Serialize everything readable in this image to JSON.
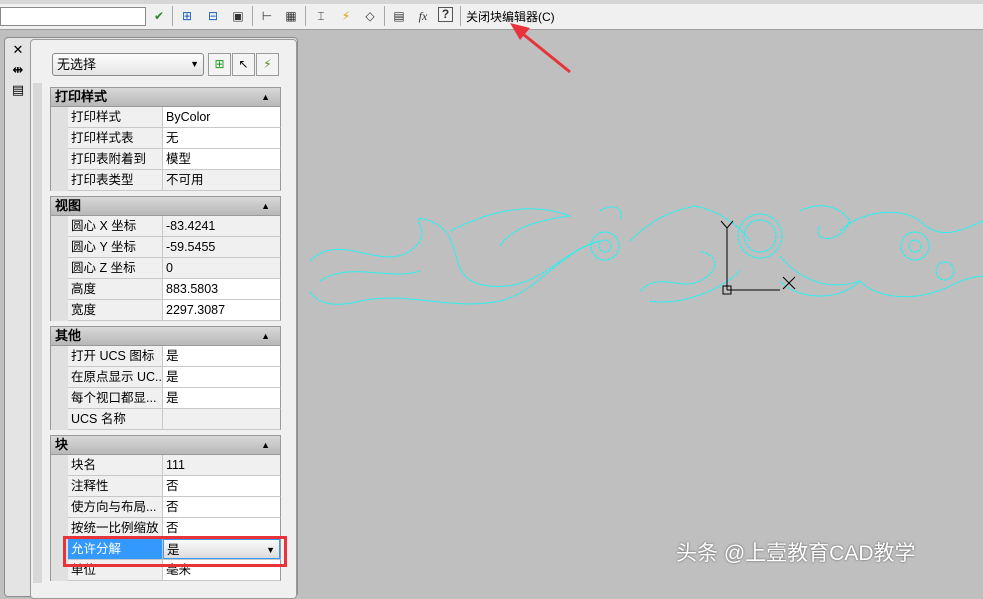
{
  "toolbar": {
    "close_block_editor": "关闭块编辑器(C)",
    "icons": [
      "block-authoring-icon",
      "parameter-icon",
      "action-icon",
      "visibility-icon",
      "constraint-icon",
      "table-icon",
      "attribute-icon",
      "lightning-icon",
      "tag-icon",
      "manager-icon",
      "fx-icon",
      "help-icon"
    ],
    "fx": "fx",
    "help": "?"
  },
  "palette": {
    "side_close": "✕",
    "selection": "无选择",
    "sections": [
      {
        "title": "打印样式",
        "rows": [
          {
            "k": "打印样式",
            "v": "ByColor"
          },
          {
            "k": "打印样式表",
            "v": "无"
          },
          {
            "k": "打印表附着到",
            "v": "模型"
          },
          {
            "k": "打印表类型",
            "v": "不可用"
          }
        ]
      },
      {
        "title": "视图",
        "rows": [
          {
            "k": "圆心 X 坐标",
            "v": "-83.4241"
          },
          {
            "k": "圆心 Y 坐标",
            "v": "-59.5455"
          },
          {
            "k": "圆心 Z 坐标",
            "v": "0"
          },
          {
            "k": "高度",
            "v": "883.5803"
          },
          {
            "k": "宽度",
            "v": "2297.3087"
          }
        ]
      },
      {
        "title": "其他",
        "rows": [
          {
            "k": "打开 UCS 图标",
            "v": "是"
          },
          {
            "k": "在原点显示 UC...",
            "v": "是"
          },
          {
            "k": "每个视口都显...",
            "v": "是"
          },
          {
            "k": "UCS 名称",
            "v": ""
          }
        ]
      },
      {
        "title": "块",
        "rows": [
          {
            "k": "块名",
            "v": "111"
          },
          {
            "k": "注释性",
            "v": "否"
          },
          {
            "k": "使方向与布局...",
            "v": "否"
          },
          {
            "k": "按统一比例缩放",
            "v": "否"
          },
          {
            "k": "允许分解",
            "v": "是"
          },
          {
            "k": "单位",
            "v": "毫米"
          }
        ]
      }
    ]
  },
  "canvas": {
    "ucs_y": "Y",
    "ucs_x": "X",
    "drawing_color": "#00ffff"
  },
  "watermark": "头条 @上壹教育CAD教学",
  "colors": {
    "highlight": "#e8333a",
    "selection": "#3399ff"
  }
}
